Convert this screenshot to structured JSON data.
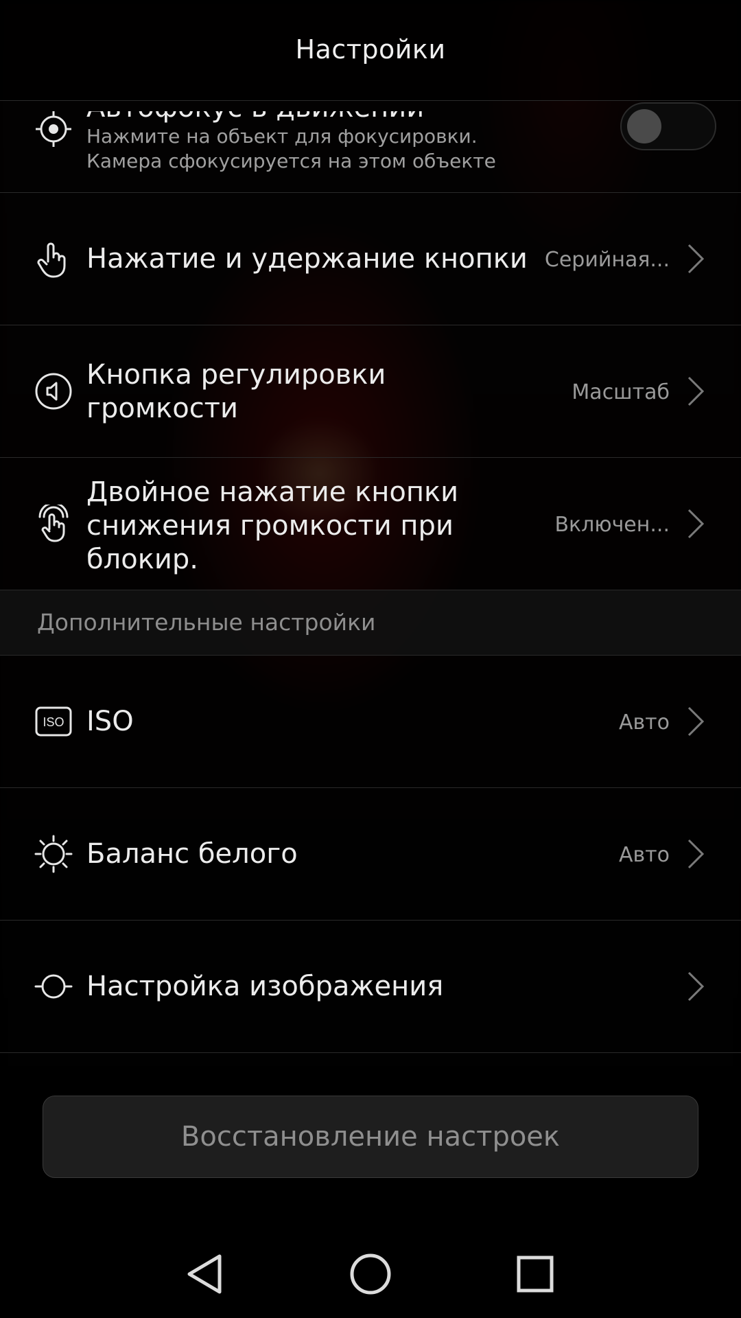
{
  "header": {
    "title": "Настройки"
  },
  "items": [
    {
      "icon": "focus-target-icon",
      "title": "Автофокус в движении",
      "subtitle": "Нажмите на объект для фокусировки. Камера сфокусируется на этом объекте",
      "toggle_state": "off"
    },
    {
      "icon": "hand-touch-icon",
      "title": "Нажатие и удержание кнопки",
      "value": "Серийная..."
    },
    {
      "icon": "volume-icon",
      "title_line1": "Кнопка регулировки",
      "title_line2": "громкости",
      "value": "Масштаб"
    },
    {
      "icon": "double-tap-icon",
      "title_line1": "Двойное нажатие кнопки",
      "title_line2": "снижения громкости при",
      "title_line3": "блокир.",
      "value": "Включен..."
    }
  ],
  "section": {
    "title": "Дополнительные настройки"
  },
  "advanced_items": [
    {
      "icon": "iso-icon",
      "icon_text": "ISO",
      "title": "ISO",
      "value": "Авто"
    },
    {
      "icon": "white-balance-sun-icon",
      "title": "Баланс белого",
      "value": "Авто"
    },
    {
      "icon": "image-adjust-icon",
      "title": "Настройка изображения",
      "value": ""
    }
  ],
  "reset_button": {
    "label": "Восстановление настроек"
  },
  "navbar": {
    "back": "back-triangle-icon",
    "home": "home-circle-icon",
    "recents": "recents-square-icon"
  }
}
